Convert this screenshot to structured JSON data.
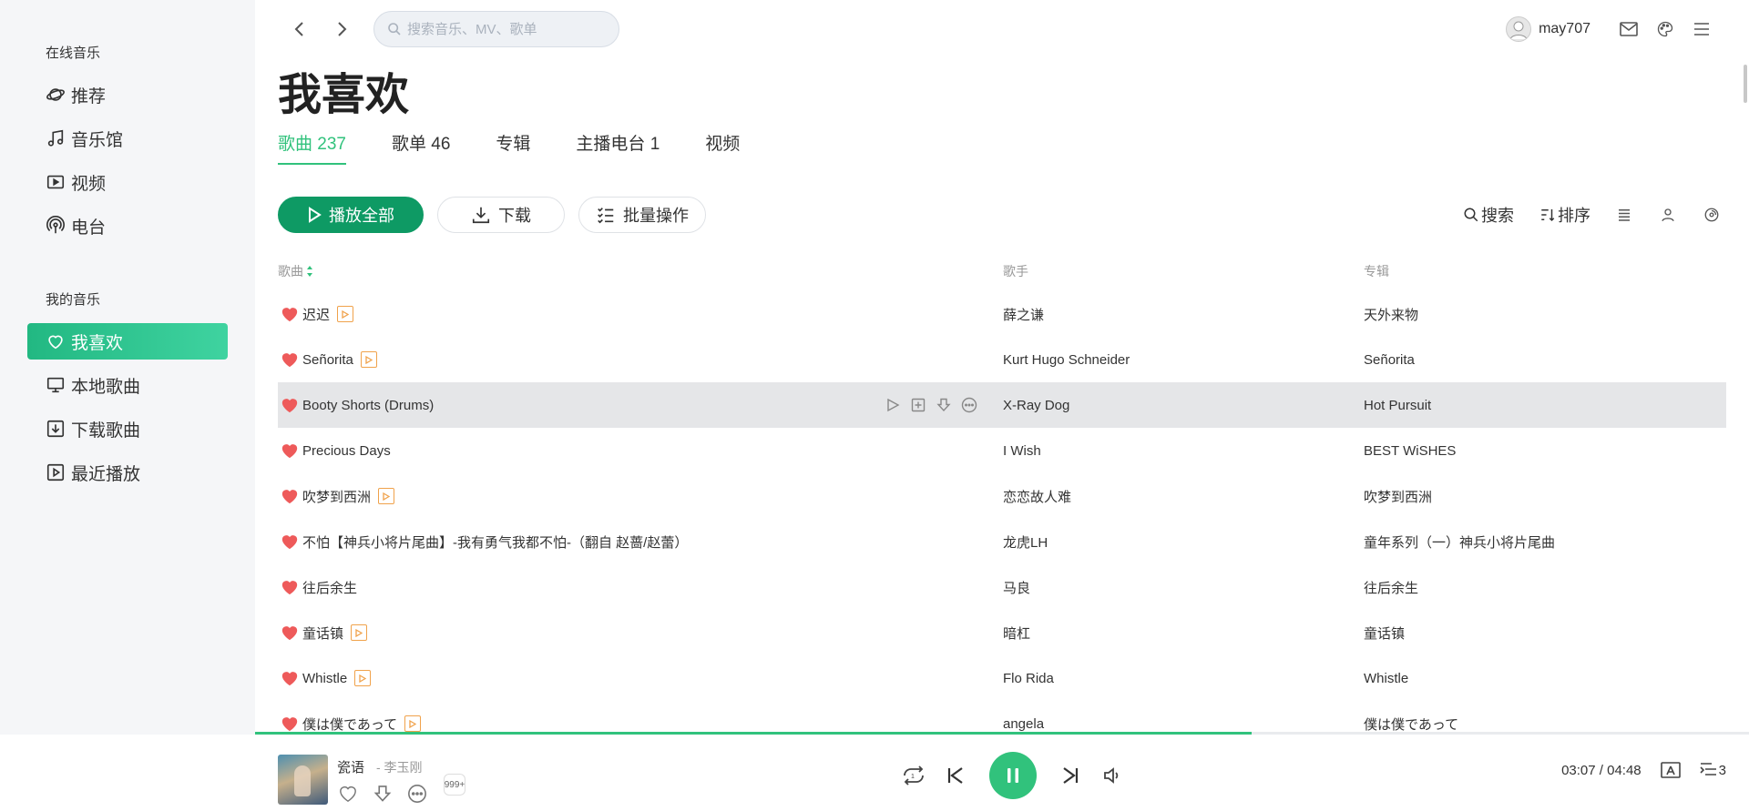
{
  "sidebar": {
    "online_title": "在线音乐",
    "online_items": [
      {
        "label": "推荐",
        "icon": "planet-icon"
      },
      {
        "label": "音乐馆",
        "icon": "music-note-icon"
      },
      {
        "label": "视频",
        "icon": "video-icon"
      },
      {
        "label": "电台",
        "icon": "radio-icon"
      }
    ],
    "my_title": "我的音乐",
    "my_items": [
      {
        "label": "我喜欢",
        "icon": "heart-icon",
        "active": true
      },
      {
        "label": "本地歌曲",
        "icon": "monitor-icon"
      },
      {
        "label": "下载歌曲",
        "icon": "download-box-icon"
      },
      {
        "label": "最近播放",
        "icon": "play-box-icon"
      }
    ]
  },
  "topbar": {
    "search_placeholder": "搜索音乐、MV、歌单",
    "username": "may707"
  },
  "page": {
    "title": "我喜欢",
    "tabs": [
      "歌曲 237",
      "歌单 46",
      "专辑",
      "主播电台 1",
      "视频"
    ],
    "active_tab": 0
  },
  "actions": {
    "play_all": "播放全部",
    "download": "下载",
    "batch": "批量操作",
    "search": "搜索",
    "sort": "排序"
  },
  "list": {
    "headers": {
      "song": "歌曲",
      "artist": "歌手",
      "album": "专辑"
    },
    "rows": [
      {
        "title": "迟迟",
        "mv": true,
        "artist": "薛之谦",
        "album": "天外来物"
      },
      {
        "title": "Señorita",
        "mv": true,
        "artist": "Kurt Hugo Schneider",
        "album": "Señorita"
      },
      {
        "title": "Booty Shorts (Drums)",
        "mv": false,
        "artist": "X-Ray Dog",
        "album": "Hot Pursuit",
        "hover": true
      },
      {
        "title": "Precious Days",
        "mv": false,
        "artist": "I Wish",
        "album": "BEST WiSHES"
      },
      {
        "title": "吹梦到西洲",
        "mv": true,
        "artist": "恋恋故人难",
        "album": "吹梦到西洲"
      },
      {
        "title": "不怕【神兵小将片尾曲】-我有勇气我都不怕-（翻自 赵蔷/赵蕾）",
        "mv": false,
        "artist": "龙虎LH",
        "album": "童年系列（一）神兵小将片尾曲"
      },
      {
        "title": "往后余生",
        "mv": false,
        "artist": "马良",
        "album": "往后余生"
      },
      {
        "title": "童话镇",
        "mv": true,
        "artist": "暗杠",
        "album": "童话镇"
      },
      {
        "title": "Whistle",
        "mv": true,
        "artist": "Flo Rida",
        "album": "Whistle"
      },
      {
        "title": "僕は僕であって",
        "mv": true,
        "artist": "angela",
        "album": "僕は僕であって"
      }
    ]
  },
  "player": {
    "song": "瓷语",
    "artist": "- 李玉刚",
    "comment_badge": "999+",
    "time": "03:07 / 04:48",
    "progress": 0.667,
    "queue_count": "3"
  },
  "colors": {
    "accent": "#31c27c",
    "primary_button": "#0e9a64",
    "heart": "#ee5a5a",
    "mv_badge": "#f0a24b"
  }
}
